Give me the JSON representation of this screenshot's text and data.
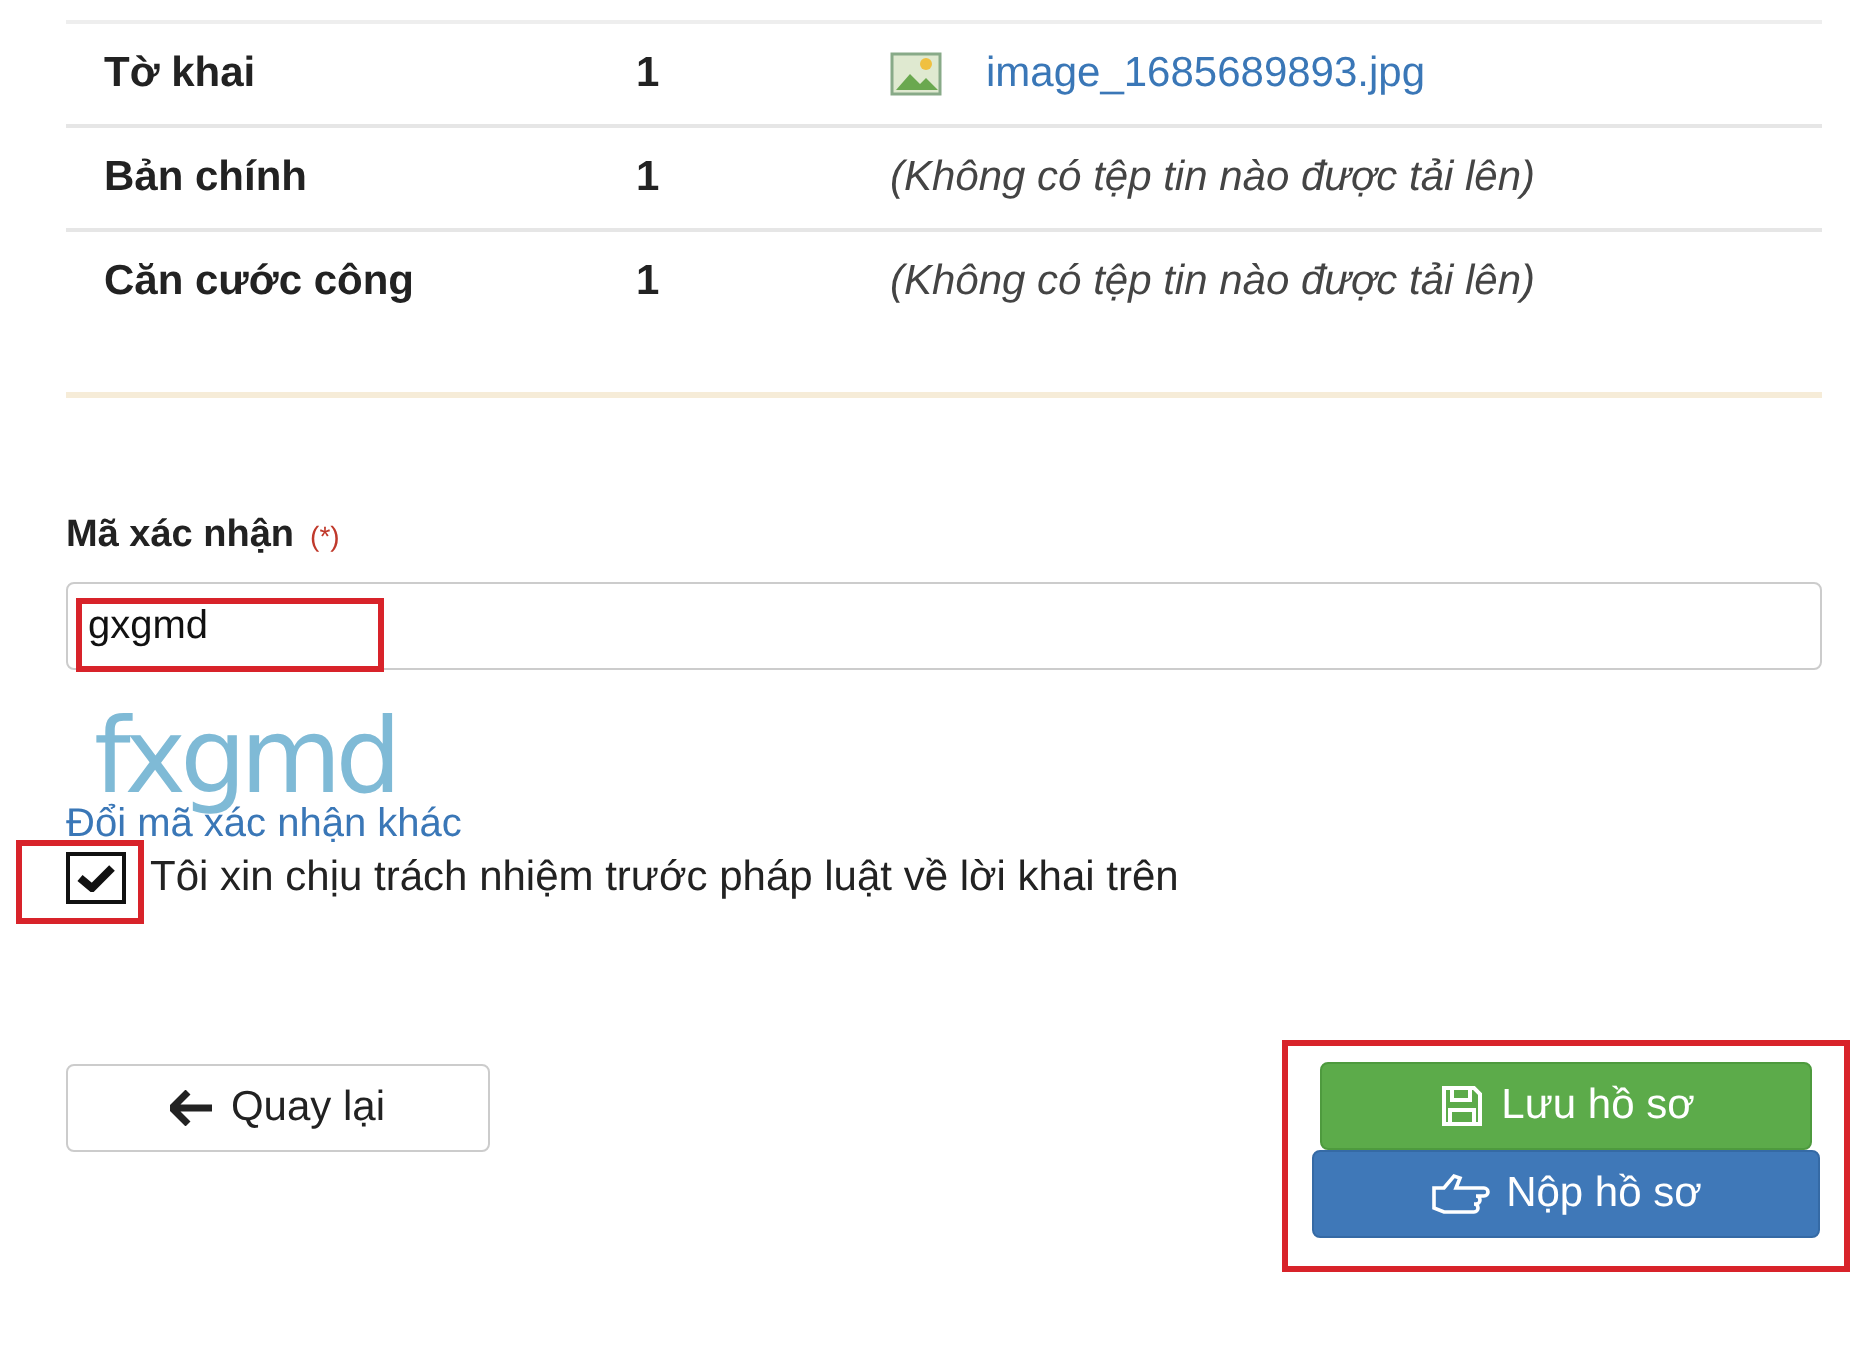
{
  "documents": [
    {
      "name": "Tờ khai",
      "count": "1",
      "kind": "file",
      "file": "image_1685689893.jpg"
    },
    {
      "name": "Bản chính",
      "count": "1",
      "kind": "empty",
      "file": "(Không có tệp tin nào được tải lên)"
    },
    {
      "name": "Căn cước công",
      "count": "1",
      "kind": "empty",
      "file": "(Không có tệp tin nào được tải lên)"
    }
  ],
  "captcha": {
    "label": "Mã xác nhận",
    "required_mark": "(*)",
    "value": "gxgmd",
    "image_text": "fxgmd",
    "refresh_link": "Đổi mã xác nhận khác"
  },
  "agreement": {
    "checked": true,
    "label": "Tôi xin chịu trách nhiệm trước pháp luật về lời khai trên"
  },
  "buttons": [
    {
      "kind": "back",
      "label": "Quay lại"
    },
    {
      "kind": "save",
      "label": "Lưu hồ sơ"
    },
    {
      "kind": "submit",
      "label": "Nộp hồ sơ"
    }
  ]
}
